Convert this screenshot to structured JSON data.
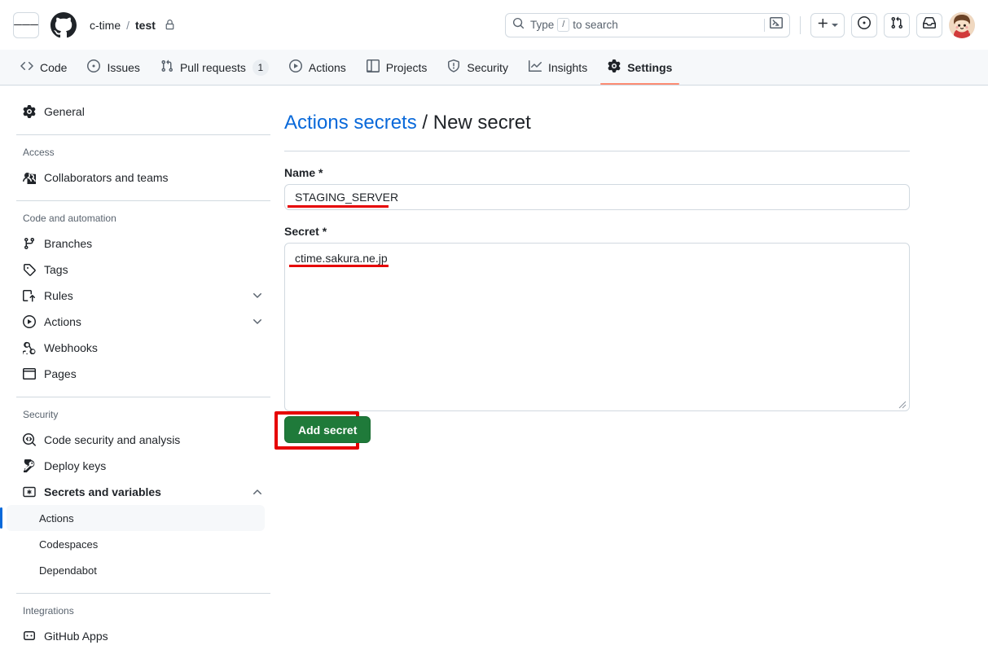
{
  "header": {
    "menu_icon": "hamburger-menu-icon",
    "logo_icon": "github-logo-icon",
    "breadcrumb": {
      "owner": "c-time",
      "separator": "/",
      "repo": "test",
      "visibility_icon": "lock-icon"
    },
    "search": {
      "icon": "search-icon",
      "placeholder_pre": "Type",
      "placeholder_key": "/",
      "placeholder_post": "to search",
      "terminal_icon": "command-palette-icon"
    },
    "actions": [
      {
        "name": "create-new-menu",
        "icon": "plus-icon",
        "caret": true
      },
      {
        "name": "issues-button",
        "icon": "issue-opened-icon"
      },
      {
        "name": "pull-requests-button",
        "icon": "git-pull-request-icon"
      },
      {
        "name": "notifications-button",
        "icon": "inbox-icon"
      }
    ],
    "avatar": "user-avatar"
  },
  "repo_nav": {
    "tabs": [
      {
        "label": "Code",
        "icon": "code-icon",
        "active": false,
        "count": null
      },
      {
        "label": "Issues",
        "icon": "issue-opened-icon",
        "active": false,
        "count": null
      },
      {
        "label": "Pull requests",
        "icon": "git-pull-request-icon",
        "active": false,
        "count": "1"
      },
      {
        "label": "Actions",
        "icon": "play-icon",
        "active": false,
        "count": null
      },
      {
        "label": "Projects",
        "icon": "table-icon",
        "active": false,
        "count": null
      },
      {
        "label": "Security",
        "icon": "shield-icon",
        "active": false,
        "count": null
      },
      {
        "label": "Insights",
        "icon": "graph-icon",
        "active": false,
        "count": null
      },
      {
        "label": "Settings",
        "icon": "gear-icon",
        "active": true,
        "count": null
      }
    ],
    "active_underline_color": "#fd8c73"
  },
  "sidebar": {
    "general": {
      "label": "General",
      "icon": "gear-icon"
    },
    "sections": [
      {
        "title": "Access",
        "items": [
          {
            "label": "Collaborators and teams",
            "icon": "people-icon",
            "chevron": null,
            "bold": false
          }
        ]
      },
      {
        "title": "Code and automation",
        "items": [
          {
            "label": "Branches",
            "icon": "git-branch-icon",
            "chevron": null,
            "bold": false
          },
          {
            "label": "Tags",
            "icon": "tag-icon",
            "chevron": null,
            "bold": false
          },
          {
            "label": "Rules",
            "icon": "rules-icon",
            "chevron": "down",
            "bold": false
          },
          {
            "label": "Actions",
            "icon": "play-icon",
            "chevron": "down",
            "bold": false
          },
          {
            "label": "Webhooks",
            "icon": "webhook-icon",
            "chevron": null,
            "bold": false
          },
          {
            "label": "Pages",
            "icon": "browser-icon",
            "chevron": null,
            "bold": false
          }
        ]
      },
      {
        "title": "Security",
        "items": [
          {
            "label": "Code security and analysis",
            "icon": "codescan-icon",
            "chevron": null,
            "bold": false
          },
          {
            "label": "Deploy keys",
            "icon": "key-icon",
            "chevron": null,
            "bold": false
          },
          {
            "label": "Secrets and variables",
            "icon": "asterisk-key-icon",
            "chevron": "up",
            "bold": true
          }
        ],
        "subitems": [
          {
            "label": "Actions",
            "selected": true
          },
          {
            "label": "Codespaces",
            "selected": false
          },
          {
            "label": "Dependabot",
            "selected": false
          }
        ]
      },
      {
        "title": "Integrations",
        "items": [
          {
            "label": "GitHub Apps",
            "icon": "github-apps-icon",
            "chevron": null,
            "bold": false
          }
        ]
      }
    ],
    "selected_accent_color": "#0969da",
    "selected_bg_color": "#f6f8fa"
  },
  "main": {
    "title_link": "Actions secrets",
    "title_separator": "/",
    "title_current": "New secret",
    "name_field": {
      "label": "Name *",
      "value": "STAGING_SERVER",
      "placeholder": ""
    },
    "secret_field": {
      "label": "Secret *",
      "value": "ctime.sakura.ne.jp",
      "placeholder": ""
    },
    "submit_button": {
      "label": "Add secret",
      "color": "#1f7a3a"
    },
    "annotation_color": "#e60000"
  }
}
